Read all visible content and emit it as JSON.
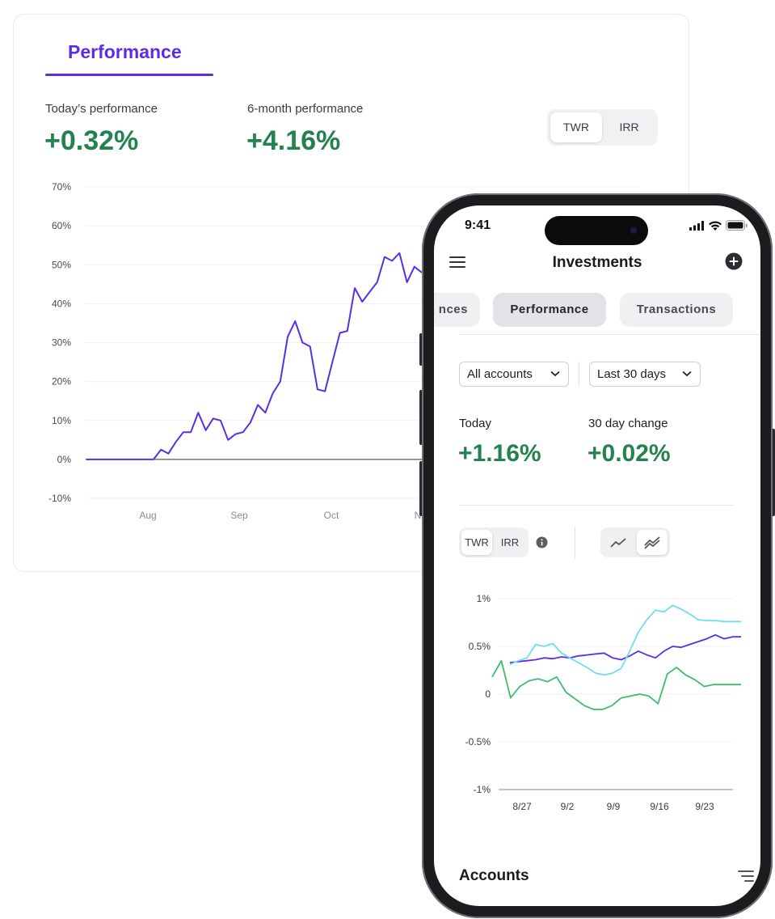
{
  "desktop": {
    "tab_label": "Performance",
    "today_label": "Today’s performance",
    "today_value": "+0.32%",
    "six_month_label": "6-month performance",
    "six_month_value": "+4.16%",
    "toggle": [
      "TWR",
      "IRR"
    ],
    "toggle_selected": "TWR"
  },
  "phone": {
    "status_time": "9:41",
    "title": "Investments",
    "tabs": [
      "nces",
      "Performance",
      "Transactions"
    ],
    "tab_selected": "Performance",
    "account_filter": "All accounts",
    "range_filter": "Last 30 days",
    "today_label": "Today",
    "today_value": "+1.16%",
    "change_label": "30 day change",
    "change_value": "+0.02%",
    "toggle": [
      "TWR",
      "IRR"
    ],
    "toggle_selected": "TWR",
    "chart_view_selected": "multi-line",
    "section_title": "Accounts",
    "icons": [
      "menu-icon",
      "add-circle-icon",
      "info-icon",
      "line-chart-icon",
      "multi-line-chart-icon",
      "sort-icon",
      "signal-icon",
      "wifi-icon",
      "battery-icon"
    ]
  },
  "colors": {
    "accent": "#5a2ee6",
    "positive": "#24824f",
    "cyan": "#6fdcf2",
    "green": "#3cbf6d"
  },
  "chart_data": [
    {
      "type": "line",
      "title": "",
      "xlabel": "",
      "ylabel": "",
      "y_ticks": [
        "70%",
        "60%",
        "50%",
        "40%",
        "30%",
        "20%",
        "10%",
        "0%",
        "-10%"
      ],
      "x_ticks": [
        "Aug",
        "Sep",
        "Oct",
        "N"
      ],
      "ylim": [
        -10,
        70
      ],
      "grid": true,
      "series": [
        {
          "values": [
            0,
            0,
            0,
            0,
            0,
            0,
            0,
            0,
            0,
            0,
            2.5,
            1.5,
            4.5,
            7,
            7,
            12,
            7.5,
            10.5,
            10,
            5,
            6.5,
            7,
            9.5,
            14,
            12,
            17,
            20,
            31.5,
            35.5,
            30,
            29,
            18,
            17.5,
            25,
            32.5,
            33,
            44,
            40.5,
            43,
            45.5,
            52,
            51,
            53,
            45.5,
            49.5,
            48
          ]
        }
      ]
    },
    {
      "type": "line",
      "title": "",
      "xlabel": "",
      "ylabel": "",
      "y_ticks": [
        "1%",
        "0.5%",
        "0",
        "-0.5%",
        "-1%"
      ],
      "x_ticks": [
        "8/27",
        "9/2",
        "9/9",
        "9/16",
        "9/23"
      ],
      "ylim": [
        -1,
        1
      ],
      "grid": true,
      "series": [
        {
          "values": [
            0.33,
            0.34,
            0.35,
            0.36,
            0.38,
            0.37,
            0.39,
            0.38,
            0.4,
            0.41,
            0.42,
            0.43,
            0.38,
            0.36,
            0.4,
            0.45,
            0.41,
            0.38,
            0.45,
            0.5,
            0.49,
            0.52,
            0.55,
            0.58,
            0.62,
            0.58,
            0.6,
            0.6
          ]
        },
        {
          "values": [
            0.31,
            0.35,
            0.38,
            0.52,
            0.5,
            0.53,
            0.43,
            0.38,
            0.33,
            0.28,
            0.22,
            0.2,
            0.22,
            0.27,
            0.45,
            0.65,
            0.78,
            0.88,
            0.86,
            0.93,
            0.89,
            0.84,
            0.78,
            0.77,
            0.77,
            0.76,
            0.76,
            0.76
          ]
        },
        {
          "values": [
            0.18,
            0.35,
            -0.04,
            0.08,
            0.14,
            0.16,
            0.13,
            0.18,
            0.02,
            -0.05,
            -0.12,
            -0.16,
            -0.16,
            -0.12,
            -0.04,
            -0.02,
            0,
            -0.02,
            -0.1,
            0.21,
            0.28,
            0.2,
            0.15,
            0.08,
            0.1,
            0.1,
            0.1,
            0.1
          ]
        }
      ]
    }
  ]
}
